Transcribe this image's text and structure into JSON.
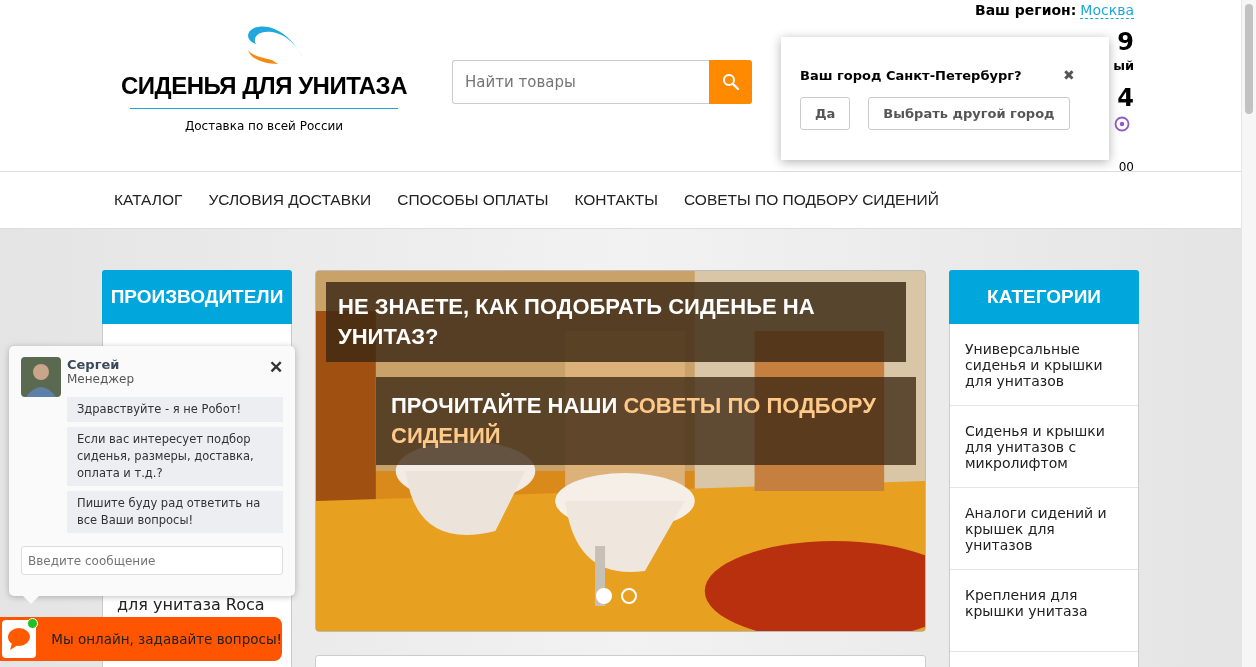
{
  "logo": {
    "title": "СИДЕНЬЯ ДЛЯ УНИТАЗА",
    "tagline": "Доставка по всей России"
  },
  "search": {
    "placeholder": "Найти товары"
  },
  "region": {
    "label": "Ваш регион:",
    "city": "Москва"
  },
  "contact_fragments": [
    "9",
    "ый",
    "4",
    "00"
  ],
  "city_popup": {
    "question": "Ваш город Санкт-Петербург?",
    "close": "✖",
    "buttons": [
      "Да",
      "Выбрать другой город"
    ]
  },
  "nav": [
    "КАТАЛОГ",
    "УСЛОВИЯ ДОСТАВКИ",
    "СПОСОБЫ ОПЛАТЫ",
    "КОНТАКТЫ",
    "СОВЕТЫ ПО ПОДБОРУ СИДЕНИЙ"
  ],
  "manufacturers": {
    "title": "ПРОИЗВОДИТЕЛИ",
    "items": [
      "для унитаза Roca"
    ]
  },
  "banner": {
    "kind": "picture",
    "heading": "НЕ ЗНАЕТЕ, КАК ПОДОБРАТЬ СИДЕНЬЕ НА УНИТАЗ?",
    "subheading": "ПРОЧИТАЙТЕ НАШИ **СОВЕТЫ ПО ПОДБОРУ СИДЕНИЙ**",
    "dots": [
      {
        "selected": true
      },
      {
        "selected": false
      }
    ]
  },
  "categories": {
    "title": "КАТЕГОРИИ",
    "items": [
      "Универсальные сиденья и крышки для унитазов",
      "Сиденья и крышки для унитазов с микролифтом",
      "Аналоги сидений и крышек для унитазов",
      "Крепления для крышки унитаза"
    ]
  },
  "chat": {
    "name": "Сергей",
    "role": "Менеджер",
    "close": "✕",
    "messages": [
      "Здравствуйте - я не Робот!",
      "Если вас интересует подбор сиденья, размеры, доставка, оплата и т.д.?",
      "Пишите буду рад ответить на все Ваши вопросы!"
    ],
    "input_placeholder": "Введите сообщение",
    "online_label": "Мы онлайн, задавайте вопросы!",
    "online": true
  }
}
